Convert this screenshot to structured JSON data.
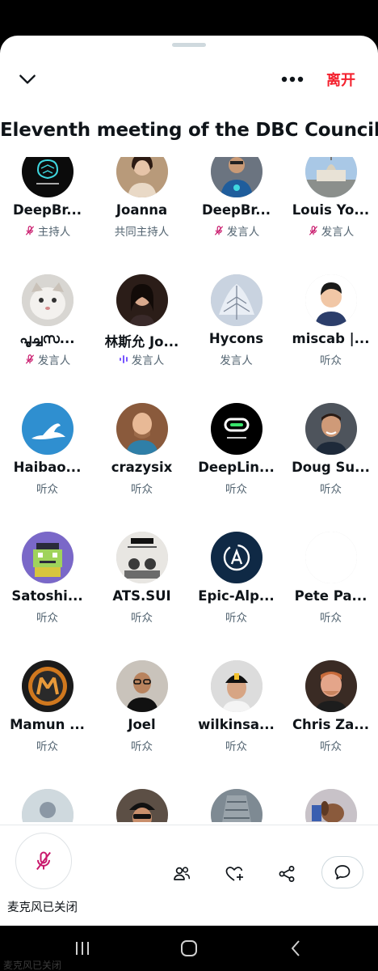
{
  "space": {
    "title": "Eleventh meeting of the DBC Council",
    "leave_label": "离开"
  },
  "participants": [
    {
      "name": "DeepBr...",
      "role": "主持人",
      "muted": true,
      "speaking": false,
      "avatar": "deepbrain-logo"
    },
    {
      "name": "Joanna",
      "role": "共同主持人",
      "muted": false,
      "speaking": false,
      "avatar": "photo-woman"
    },
    {
      "name": "DeepBr...",
      "role": "发言人",
      "muted": true,
      "speaking": false,
      "avatar": "photo-man-shirt"
    },
    {
      "name": "Louis Yo...",
      "role": "发言人",
      "muted": true,
      "speaking": false,
      "avatar": "photo-building"
    },
    {
      "name": "പൂച്ചസ...",
      "role": "发言人",
      "muted": true,
      "speaking": false,
      "avatar": "photo-cat"
    },
    {
      "name": "林斯允 Jo...",
      "role": "发言人",
      "muted": false,
      "speaking": true,
      "avatar": "photo-woman-dark"
    },
    {
      "name": "Hycons",
      "role": "发言人",
      "muted": false,
      "speaking": false,
      "avatar": "photo-snow-tree"
    },
    {
      "name": "miscab |...",
      "role": "听众",
      "muted": false,
      "speaking": false,
      "avatar": "cartoon-man"
    },
    {
      "name": "Haibao...",
      "role": "听众",
      "muted": false,
      "speaking": false,
      "avatar": "seal-logo"
    },
    {
      "name": "crazysix",
      "role": "听众",
      "muted": false,
      "speaking": false,
      "avatar": "photo-bald-man"
    },
    {
      "name": "DeepLin...",
      "role": "听众",
      "muted": false,
      "speaking": false,
      "avatar": "deeplink-logo"
    },
    {
      "name": "Doug Su...",
      "role": "听众",
      "muted": false,
      "speaking": false,
      "avatar": "photo-smiling-man"
    },
    {
      "name": "Satoshi...",
      "role": "听众",
      "muted": false,
      "speaking": false,
      "avatar": "pixel-frog"
    },
    {
      "name": "ATS.SUI",
      "role": "听众",
      "muted": false,
      "speaking": false,
      "avatar": "creed-poster"
    },
    {
      "name": "Epic-Alp...",
      "role": "听众",
      "muted": false,
      "speaking": false,
      "avatar": "epic-logo"
    },
    {
      "name": "Pete Pa...",
      "role": "听众",
      "muted": false,
      "speaking": false,
      "avatar": "blank"
    },
    {
      "name": "Mamun ...",
      "role": "听众",
      "muted": false,
      "speaking": false,
      "avatar": "m-logo"
    },
    {
      "name": "Joel",
      "role": "听众",
      "muted": false,
      "speaking": false,
      "avatar": "photo-glasses-man"
    },
    {
      "name": "wilkinsa...",
      "role": "听众",
      "muted": false,
      "speaking": false,
      "avatar": "photo-cap-man"
    },
    {
      "name": "Chris Za...",
      "role": "听众",
      "muted": false,
      "speaking": false,
      "avatar": "photo-red-man"
    },
    {
      "name": "",
      "role": "",
      "muted": false,
      "speaking": false,
      "avatar": "default-avatar"
    },
    {
      "name": "",
      "role": "",
      "muted": false,
      "speaking": false,
      "avatar": "photo-cap-sunglasses"
    },
    {
      "name": "",
      "role": "",
      "muted": false,
      "speaking": false,
      "avatar": "photo-building-tall"
    },
    {
      "name": "",
      "role": "",
      "muted": false,
      "speaking": false,
      "avatar": "photo-dog"
    }
  ],
  "bottom_bar": {
    "mic_label": "麦克风已关闭",
    "icons": [
      "participants-icon",
      "heart-add-icon",
      "share-icon",
      "chat-icon"
    ]
  },
  "ghost_text": "麦克风已关闭",
  "colors": {
    "accent_red": "#f4212e",
    "mute_pink": "#c9196c",
    "speaking_purple": "#7856ff",
    "muted_text": "#536471"
  }
}
